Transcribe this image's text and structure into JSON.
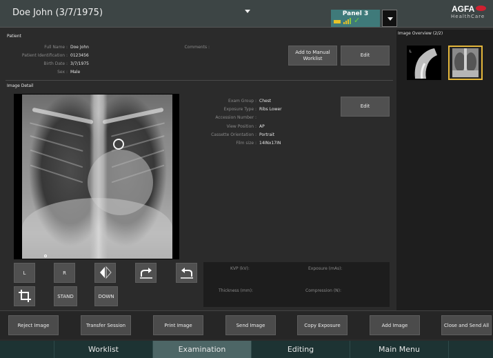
{
  "header": {
    "patient_name": "Doe John (3/7/1975)",
    "panel_title": "Panel 3",
    "logo_text": "AGFA",
    "logo_sub": "HealthCare"
  },
  "patient": {
    "section_label": "Patient",
    "fields": [
      {
        "label": "Full Name :",
        "value": "Doe John"
      },
      {
        "label": "Patient Identification :",
        "value": "0123456"
      },
      {
        "label": "Birth Date :",
        "value": "3/7/1975"
      },
      {
        "label": "Sex :",
        "value": "Male"
      }
    ],
    "comments_label": "Comments :",
    "add_worklist_label": "Add to Manual Worklist",
    "edit_label": "Edit"
  },
  "image_detail": {
    "section_label": "Image Detail",
    "fields": [
      {
        "label": "Exam Group :",
        "value": "Chest"
      },
      {
        "label": "Exposure Type :",
        "value": "Ribs Lower"
      },
      {
        "label": "Accession Number :",
        "value": ""
      },
      {
        "label": "View Position :",
        "value": "AP"
      },
      {
        "label": "Cassette Orientation :",
        "value": "Portrait"
      },
      {
        "label": "Film size :",
        "value": "14INx17IN"
      }
    ],
    "edit_label": "Edit"
  },
  "tools": {
    "l_label": "L",
    "r_label": "R",
    "stand_label": "STAND",
    "down_label": "DOWN"
  },
  "exposure": {
    "kvp_label": "KVP (kV):",
    "exposure_label": "Exposure (mAs):",
    "thickness_label": "Thickness (mm):",
    "compression_label": "Compression (N):"
  },
  "overview": {
    "label": "Image Overview (2/2)"
  },
  "actions": [
    "Reject Image",
    "Transfer Session",
    "Print Image",
    "Send Image",
    "Copy Exposure",
    "Add Image",
    "Close and Send All"
  ],
  "nav": {
    "tabs": [
      "Worklist",
      "Examination",
      "Editing",
      "Main Menu"
    ],
    "active": "Examination"
  },
  "colors": {
    "accent": "#4d6666",
    "selected_thumb": "#e5b73b",
    "panel_status": "#3f7a7a"
  }
}
